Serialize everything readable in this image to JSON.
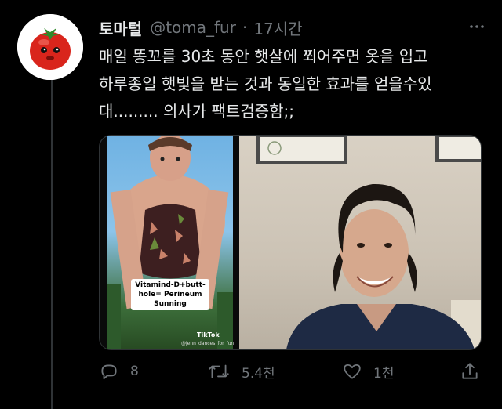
{
  "tweet": {
    "display_name": "토마털",
    "handle": "@toma_fur",
    "separator": "·",
    "time": "17시간",
    "text_lines": [
      "매일 똥꼬를 30초 동안 햇살에 쬐어주면 옷을 입고",
      "하루종일 햇빛을 받는 것과 동일한 효과를 얻을수있",
      "대......... 의사가 팩트검증함;;"
    ]
  },
  "media": {
    "caption": "Vitamind-D+butt-hole= Perineum Sunning",
    "tiktok_label": "TikTok",
    "tiktok_user": "@jenn_dances_for_fun"
  },
  "actions": {
    "reply_count": "8",
    "retweet_count": "5.4천",
    "like_count": "1천"
  },
  "icons": {
    "more": "more-icon",
    "reply": "reply-icon",
    "retweet": "retweet-icon",
    "like": "heart-icon",
    "share": "share-icon"
  },
  "colors": {
    "background": "#000000",
    "text": "#e7e9ea",
    "secondary_text": "#71767b",
    "avatar_tomato": "#d9251c"
  }
}
